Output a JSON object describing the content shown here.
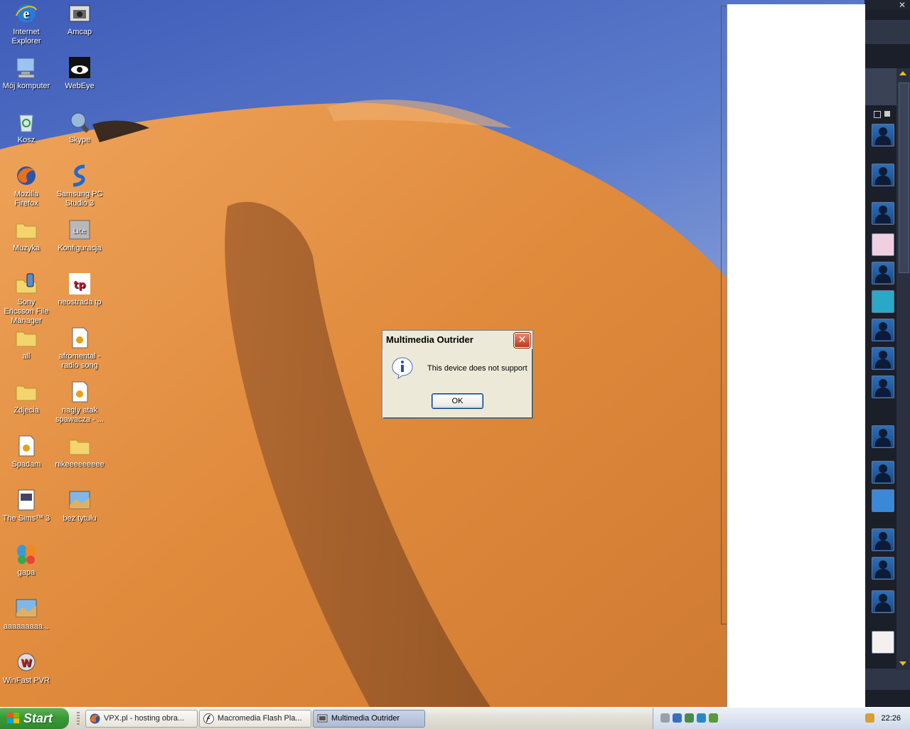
{
  "desktop": {
    "icons": [
      {
        "label": "Internet Explorer",
        "icon": "ie-icon"
      },
      {
        "label": "Amcap",
        "icon": "amcap-icon"
      },
      {
        "label": "Mój komputer",
        "icon": "computer-icon"
      },
      {
        "label": "WebEye",
        "icon": "webeye-icon"
      },
      {
        "label": "Kosz",
        "icon": "recycle-bin-icon"
      },
      {
        "label": "Skype",
        "icon": "skype-icon"
      },
      {
        "label": "Mozilla Firefox",
        "icon": "firefox-icon"
      },
      {
        "label": "Samsung PC Studio 3",
        "icon": "samsung-icon"
      },
      {
        "label": "Muzyka",
        "icon": "folder-icon"
      },
      {
        "label": "Konfiguracja",
        "icon": "config-icon"
      },
      {
        "label": "Sony Ericsson File Manager",
        "icon": "sony-ericsson-icon"
      },
      {
        "label": "neostrada tp",
        "icon": "neostrada-icon"
      },
      {
        "label": "all",
        "icon": "folder-icon"
      },
      {
        "label": "afromental - radio song",
        "icon": "audio-file-icon"
      },
      {
        "label": "Zdjecia",
        "icon": "folder-icon"
      },
      {
        "label": "nagly atak spawacza - ...",
        "icon": "audio-file-icon"
      },
      {
        "label": "Spadam",
        "icon": "audio-file-icon"
      },
      {
        "label": "nikeeeeeeeee",
        "icon": "folder-icon"
      },
      {
        "label": "The Sims™ 3",
        "icon": "sims-icon"
      },
      {
        "label": "bez tytułu",
        "icon": "image-file-icon"
      },
      {
        "label": "gapa",
        "icon": "msn-butterfly-icon"
      },
      {
        "label": "aaaaaaaaa...",
        "icon": "image-file-icon"
      },
      {
        "label": "WinFast PVR",
        "icon": "winfast-icon"
      }
    ]
  },
  "dialog": {
    "title": "Multimedia Outrider",
    "message": "This device does not support",
    "ok_label": "OK",
    "close_symbol": "✕"
  },
  "right_panel": {
    "close_symbol": "✕"
  },
  "taskbar": {
    "start_label": "Start",
    "buttons": [
      {
        "label": "VPX.pl - hosting obra...",
        "icon": "firefox-icon"
      },
      {
        "label": "Macromedia Flash Pla...",
        "icon": "flash-icon"
      },
      {
        "label": "Multimedia Outrider",
        "icon": "outrider-icon",
        "active": true
      }
    ],
    "clock": "22:26"
  },
  "colors": {
    "sky": "#4a66c0",
    "dune": "#e08a3c",
    "dune_shadow": "#9a5a2a",
    "taskbar": "#e3e1d8",
    "start_green": "#3b9a37"
  }
}
